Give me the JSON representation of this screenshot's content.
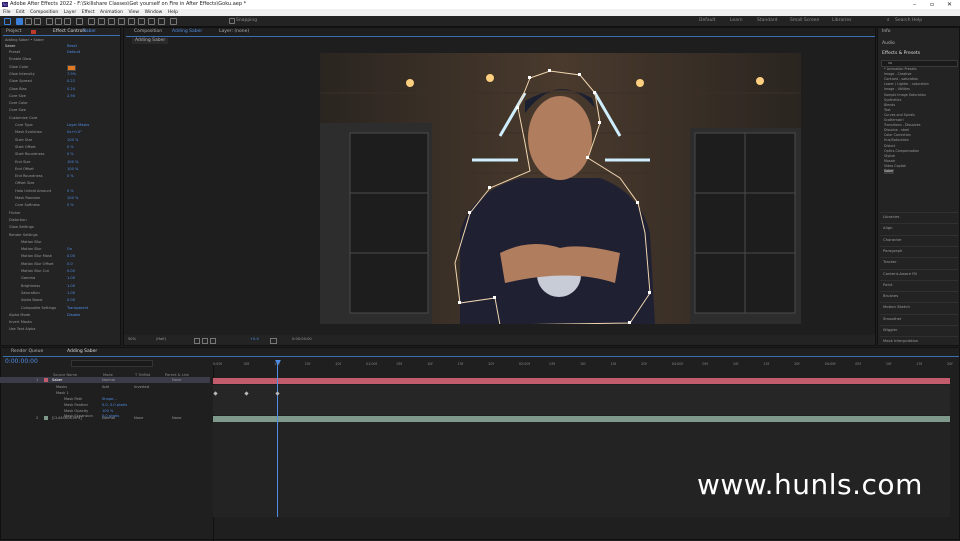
{
  "window": {
    "title": "Adobe After Effects 2022 - F:\\Skillshare Classes\\Get yourself on Fire in After Effects\\Goku.aep *"
  },
  "menu": [
    "File",
    "Edit",
    "Composition",
    "Layer",
    "Effect",
    "Animation",
    "View",
    "Window",
    "Help"
  ],
  "toolbar": {
    "snapping_label": "Snapping",
    "workspaces": [
      "Default",
      "Learn",
      "Standard",
      "Small Screen",
      "Libraries"
    ],
    "search_help": "Search Help"
  },
  "project_panel": {
    "tab_project": "Project",
    "tab_effect_controls": "Effect Controls",
    "effect_target": "Saber",
    "breadcrumb": "Adding Saber • Saber",
    "effect_name": "Saber",
    "reset": "Reset",
    "params": [
      {
        "label": "Preset",
        "value": "Default"
      },
      {
        "label": "Enable Glow",
        "value": ""
      },
      {
        "label": "Glow Color",
        "value": ""
      },
      {
        "label": "Glow Intensity",
        "value": "7.9%"
      },
      {
        "label": "Glow Spread",
        "value": "0.22"
      },
      {
        "label": "Glow Bias",
        "value": "0.24"
      },
      {
        "label": "Core Size",
        "value": "2.90"
      },
      {
        "label": "Core Color",
        "value": ""
      },
      {
        "label": "Core Size",
        "value": ""
      },
      {
        "label": "Customize Core",
        "value": ""
      },
      {
        "label": "Core Type",
        "value": "Layer Masks"
      },
      {
        "label": "Mask Evolution",
        "value": "0x+0.0°"
      },
      {
        "label": "Start Size",
        "value": "100 %"
      },
      {
        "label": "Start Offset",
        "value": "0 %"
      },
      {
        "label": "Start Roundness",
        "value": "0 %"
      },
      {
        "label": "End Size",
        "value": "100 %"
      },
      {
        "label": "End Offset",
        "value": "100 %"
      },
      {
        "label": "End Roundness",
        "value": "0 %"
      },
      {
        "label": "Offset Size",
        "value": ""
      },
      {
        "label": "Halo Unfold Amount",
        "value": "0 %"
      },
      {
        "label": "Mask Random",
        "value": "100 %"
      },
      {
        "label": "Core Softness",
        "value": "0 %"
      },
      {
        "label": "Flicker",
        "value": ""
      },
      {
        "label": "Distortion",
        "value": ""
      },
      {
        "label": "Glow Settings",
        "value": ""
      },
      {
        "label": "Render Settings",
        "value": ""
      },
      {
        "label": "Motion Blur",
        "value": ""
      },
      {
        "label": "Motion Blur",
        "value": "On"
      },
      {
        "label": "Motion Blur Mask",
        "value": "0.00"
      },
      {
        "label": "Motion Blur Offset",
        "value": "0.0"
      },
      {
        "label": "Motion Blur Cut",
        "value": "0.00"
      },
      {
        "label": "Gamma",
        "value": "1.00"
      },
      {
        "label": "Brightness",
        "value": "1.00"
      },
      {
        "label": "Saturation",
        "value": "1.00"
      },
      {
        "label": "Alpha Boost",
        "value": "0.00"
      },
      {
        "label": "Composite Settings",
        "value": "Transparent"
      },
      {
        "label": "Alpha Mode",
        "value": "Disable"
      },
      {
        "label": "Invert Masks",
        "value": ""
      },
      {
        "label": "Use Text Alpha",
        "value": ""
      }
    ]
  },
  "composition_panel": {
    "tab": "Composition",
    "comp_name": "Adding Saber",
    "layer_tab": "Layer: (none)",
    "comp_tab": "Adding Saber",
    "zoom": "50%",
    "resolution": "(Half)",
    "exposure": "+0.0",
    "timecode": "0:00:00:00"
  },
  "right_panel": {
    "sections": [
      "Info",
      "Audio",
      "Effects & Presets"
    ],
    "search_value": "sa",
    "tree": [
      "* Animation Presets",
      "Image - Creative",
      "Contrast - saturation",
      "Lower / Lighter - saturation",
      "Image - Utilities",
      "Sample Image Saturation",
      "Synthetics",
      "Blends",
      "Text",
      "Curves and Spirals",
      "Scatterswirl",
      "Transitions - Dissolves",
      "Dissolve - steel",
      "Color Correction",
      "Hue/Saturation",
      "Distort",
      "Optics Compensation",
      "Stylize",
      "Mosaic",
      "Video Copilot",
      "Saber"
    ],
    "panels": [
      "Libraries",
      "Align",
      "Character",
      "Paragraph",
      "Tracker",
      "Content-Aware Fill",
      "Paint",
      "Brushes",
      "Motion Sketch",
      "Smoother",
      "Wiggler",
      "Mask Interpolation"
    ]
  },
  "timeline": {
    "tab_render": "Render Queue",
    "tab_comp": "Adding Saber",
    "timecode": "0:00:00:00",
    "columns": [
      "Source Name",
      "Mode",
      "T TrkMat",
      "Parent & Link"
    ],
    "layers": [
      {
        "num": "1",
        "name": "Saber",
        "mode": "Normal",
        "trkmat": "",
        "parent": "None"
      },
      {
        "num": "",
        "name": "Masks",
        "mode": "Add",
        "trkmat": "Inverted",
        "parent": ""
      },
      {
        "num": "",
        "name": "Mask 1",
        "mode": "",
        "trkmat": "",
        "parent": ""
      },
      {
        "num": "",
        "name": "Mask Path",
        "mode": "Shape...",
        "trkmat": "",
        "parent": ""
      },
      {
        "num": "",
        "name": "Mask Feather",
        "mode": "0.0, 0.0 pixels",
        "trkmat": "",
        "parent": ""
      },
      {
        "num": "",
        "name": "Mask Opacity",
        "mode": "100 %",
        "trkmat": "",
        "parent": ""
      },
      {
        "num": "",
        "name": "Mask Expansion",
        "mode": "0.0 pixels",
        "trkmat": "",
        "parent": ""
      },
      {
        "num": "2",
        "name": "[CL44SR08.MP4]",
        "mode": "Normal",
        "trkmat": "None",
        "parent": "None"
      }
    ],
    "ruler": [
      "0:00f",
      "05f",
      "10f",
      "15f",
      "20f",
      "01:00f",
      "05f",
      "10f",
      "15f",
      "20f",
      "02:00f",
      "05f",
      "10f",
      "15f",
      "20f",
      "03:00f",
      "05f",
      "10f",
      "15f",
      "20f",
      "04:00f",
      "05f",
      "10f",
      "15f",
      "20f"
    ]
  },
  "watermark": "www.hunls.com",
  "colors": {
    "accent": "#4f8de6",
    "saber_track": "#c25b6b",
    "footage_track": "#7f9a8c",
    "viewer_bg": "#2b2621"
  }
}
